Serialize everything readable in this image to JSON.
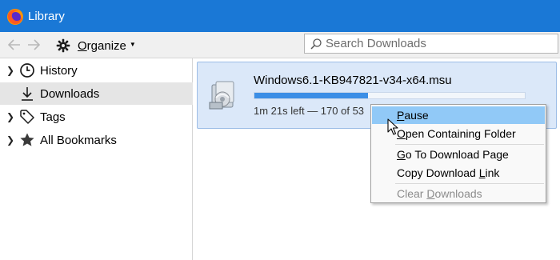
{
  "window": {
    "title": "Library",
    "accent": "#1a78d6"
  },
  "toolbar": {
    "back_icon": "arrow-left-icon",
    "forward_icon": "arrow-right-icon",
    "organize_prefix": "",
    "organize_accel": "O",
    "organize_rest": "rganize",
    "search": {
      "placeholder": "Search Downloads",
      "value": ""
    }
  },
  "sidebar": {
    "items": [
      {
        "label": "History",
        "icon": "clock-icon",
        "expandable": true
      },
      {
        "label": "Downloads",
        "icon": "download-icon",
        "expandable": false,
        "selected": true
      },
      {
        "label": "Tags",
        "icon": "tag-icon",
        "expandable": true
      },
      {
        "label": "All Bookmarks",
        "icon": "star-icon",
        "expandable": true
      }
    ]
  },
  "download": {
    "file_name": "Windows6.1-KB947821-v34-x64.msu",
    "status": "1m 21s left — 170 of 53",
    "progress": 0.42,
    "icon": "installer-package-icon"
  },
  "context_menu": {
    "items": [
      {
        "pre": "",
        "accel": "P",
        "post": "ause",
        "state": "hover"
      },
      {
        "pre": "",
        "accel": "O",
        "post": "pen Containing Folder",
        "state": "normal"
      },
      {
        "pre": "",
        "accel": "G",
        "post": "o To Download Page",
        "state": "normal"
      },
      {
        "pre": "Copy Download ",
        "accel": "L",
        "post": "ink",
        "state": "normal"
      },
      {
        "pre": "Clear ",
        "accel": "D",
        "post": "ownloads",
        "state": "disabled"
      }
    ]
  }
}
